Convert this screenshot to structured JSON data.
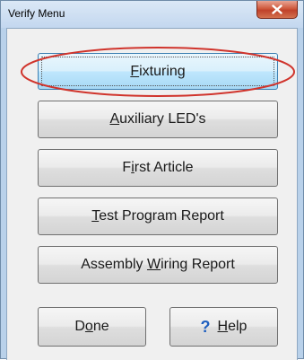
{
  "window": {
    "title": "Verify Menu"
  },
  "buttons": {
    "fixturing": {
      "prefix": "",
      "hotkey": "F",
      "suffix": "ixturing"
    },
    "auxiliary": {
      "prefix": "",
      "hotkey": "A",
      "suffix": "uxiliary LED's"
    },
    "first_article": {
      "prefix": "F",
      "hotkey": "i",
      "suffix": "rst Article"
    },
    "test_program": {
      "prefix": "",
      "hotkey": "T",
      "suffix": "est Program Report"
    },
    "assembly_wiring": {
      "prefix": "Assembly ",
      "hotkey": "W",
      "suffix": "iring Report"
    },
    "done": {
      "prefix": "D",
      "hotkey": "o",
      "suffix": "ne"
    },
    "help": {
      "icon_symbol": "?",
      "prefix": "",
      "hotkey": "H",
      "suffix": "elp"
    }
  },
  "icons": {
    "close": "close-icon",
    "help": "help-question-icon"
  },
  "colors": {
    "annotation_ellipse": "#d0342c",
    "help_icon": "#1f5fbf",
    "focused_button": "#bee6fd"
  }
}
